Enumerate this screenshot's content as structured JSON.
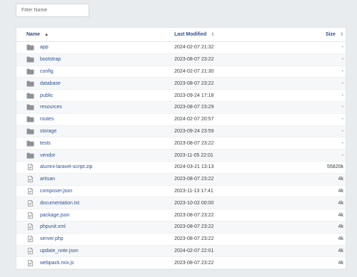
{
  "filter": {
    "placeholder": "Filter Name",
    "value": ""
  },
  "table": {
    "headers": {
      "name": "Name",
      "modified": "Last Modified",
      "size": "Size"
    },
    "sort_icons": {
      "name": "▲",
      "modified": "⇕",
      "size": "⇕"
    },
    "rows": [
      {
        "name": "app",
        "modified": "2024-02-07 21:32",
        "size": "-",
        "type": "folder"
      },
      {
        "name": "bootstrap",
        "modified": "2023-08-07 23:22",
        "size": "-",
        "type": "folder"
      },
      {
        "name": "config",
        "modified": "2024-02-07 21:30",
        "size": "-",
        "type": "folder"
      },
      {
        "name": "database",
        "modified": "2023-08-07 23:22",
        "size": "-",
        "type": "folder"
      },
      {
        "name": "public",
        "modified": "2023-09-24 17:18",
        "size": "-",
        "type": "folder"
      },
      {
        "name": "resources",
        "modified": "2023-08-07 23:29",
        "size": "-",
        "type": "folder"
      },
      {
        "name": "routes",
        "modified": "2024-02-07 20:57",
        "size": "-",
        "type": "folder"
      },
      {
        "name": "storage",
        "modified": "2023-09-24 23:59",
        "size": "-",
        "type": "folder"
      },
      {
        "name": "tests",
        "modified": "2023-08-07 23:22",
        "size": "-",
        "type": "folder"
      },
      {
        "name": "vendor",
        "modified": "2023-11-05 22:01",
        "size": "-",
        "type": "folder"
      },
      {
        "name": "alumni-laravel-script.zip",
        "modified": "2024-03-21 13:13",
        "size": "55820k",
        "type": "file"
      },
      {
        "name": "artisan",
        "modified": "2023-08-07 23:22",
        "size": "4k",
        "type": "file"
      },
      {
        "name": "composer.json",
        "modified": "2023-11-13 17:41",
        "size": "4k",
        "type": "file"
      },
      {
        "name": "documentation.txt",
        "modified": "2023-10-02 00:00",
        "size": "4k",
        "type": "file"
      },
      {
        "name": "package.json",
        "modified": "2023-08-07 23:22",
        "size": "4k",
        "type": "file"
      },
      {
        "name": "phpunit.xml",
        "modified": "2023-08-07 23:22",
        "size": "4k",
        "type": "file"
      },
      {
        "name": "server.php",
        "modified": "2023-08-07 23:22",
        "size": "4k",
        "type": "file"
      },
      {
        "name": "update_note.json",
        "modified": "2024-02-07 22:01",
        "size": "4k",
        "type": "file"
      },
      {
        "name": "webpack.mix.js",
        "modified": "2023-08-07 23:22",
        "size": "4k",
        "type": "file"
      }
    ]
  },
  "colors": {
    "background": "#e9ecee",
    "link": "#2a5195",
    "header": "#2e4f91",
    "folder_icon": "#8b929a",
    "file_icon": "#8b929a"
  }
}
